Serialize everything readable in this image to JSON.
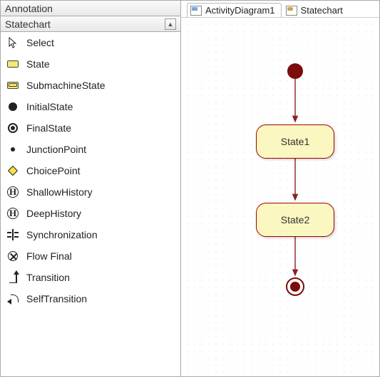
{
  "sidebar": {
    "headers": {
      "annotation": "Annotation",
      "statechart": "Statechart"
    },
    "items": [
      {
        "label": "Select"
      },
      {
        "label": "State"
      },
      {
        "label": "SubmachineState"
      },
      {
        "label": "InitialState"
      },
      {
        "label": "FinalState"
      },
      {
        "label": "JunctionPoint"
      },
      {
        "label": "ChoicePoint"
      },
      {
        "label": "ShallowHistory",
        "glyph": "H"
      },
      {
        "label": "DeepHistory",
        "glyph": "H"
      },
      {
        "label": "Synchronization"
      },
      {
        "label": "Flow Final"
      },
      {
        "label": "Transition"
      },
      {
        "label": "SelfTransition"
      }
    ]
  },
  "tabs": [
    {
      "label": "ActivityDiagram1",
      "active": true
    },
    {
      "label": "Statechart"
    }
  ],
  "diagram": {
    "states": [
      {
        "id": "state1",
        "label": "State1"
      },
      {
        "id": "state2",
        "label": "State2"
      }
    ]
  }
}
